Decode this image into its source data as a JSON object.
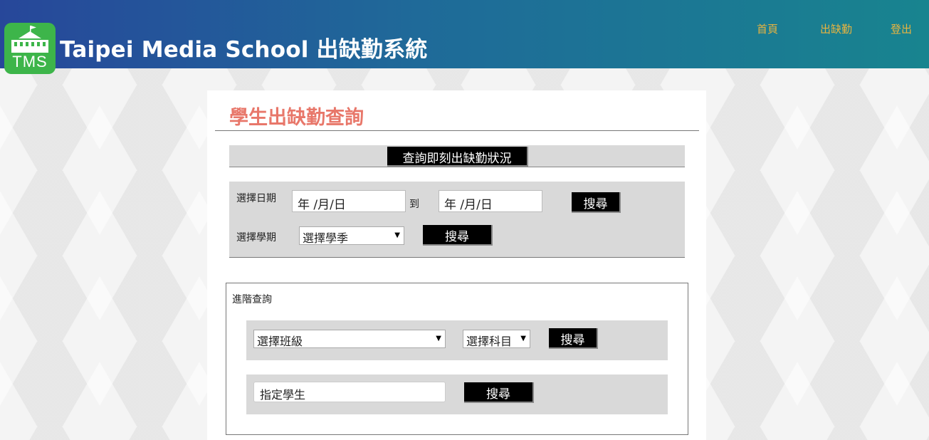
{
  "header": {
    "logo_text": "TMS",
    "title": "Taipei Media School 出缺勤系統",
    "nav": {
      "home": "首頁",
      "attendance": "出缺勤",
      "logout": "登出"
    }
  },
  "main": {
    "page_title": "學生出缺勤查詢",
    "realtime_button": "查詢即刻出缺勤狀況",
    "date_search": {
      "label": "選擇日期",
      "from_placeholder": "年 /月/日",
      "to_label": "到",
      "to_placeholder": "年 /月/日",
      "search_button": "搜尋"
    },
    "semester_search": {
      "label": "選擇學期",
      "select_value": "選擇學季",
      "search_button": "搜尋"
    },
    "advanced": {
      "legend": "進階查詢",
      "class_select": "選擇班級",
      "subject_select": "選擇科目",
      "class_search_button": "搜尋",
      "student_placeholder": "指定學生",
      "student_search_button": "搜尋"
    }
  },
  "colors": {
    "header_gradient_start": "#27479a",
    "header_gradient_end": "#18848f",
    "logo_green": "#3db54a",
    "nav_gold": "#e8b440",
    "title_salmon": "#e8776a",
    "button_black": "#000000",
    "section_gray": "#d9d9d9"
  },
  "icons": {
    "logo": "school-building-icon",
    "dropdown": "caret-down-icon"
  }
}
